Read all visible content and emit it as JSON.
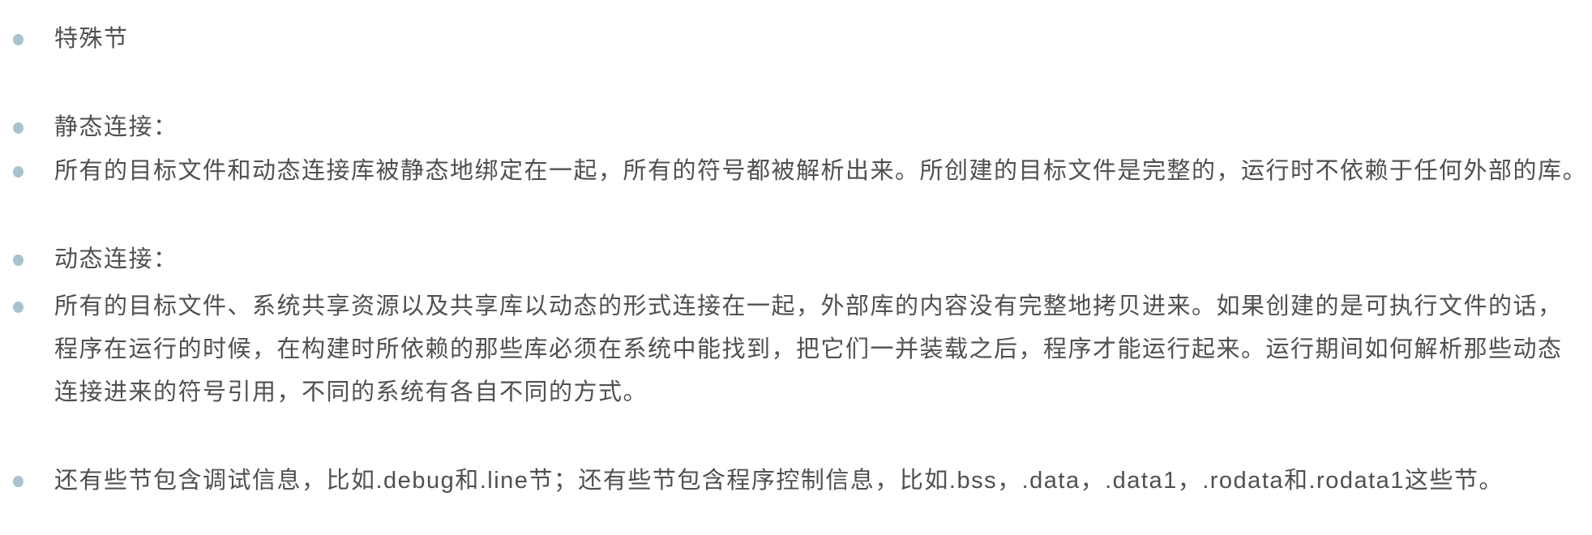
{
  "colors": {
    "bullet": "#a8c3cf",
    "text": "#505050"
  },
  "items": [
    {
      "text": "特殊节"
    },
    {
      "text": "静态连接："
    },
    {
      "text": "所有的目标文件和动态连接库被静态地绑定在一起，所有的符号都被解析出来。所创建的目标文件是完整的，运行时不依赖于任何外部的库。"
    },
    {
      "text": "动态连接："
    },
    {
      "lines": [
        "所有的目标文件、系统共享资源以及共享库以动态的形式连接在一起，外部库的内容没有完整地拷贝进来。如果创建的是可执行文件的话，",
        "程序在运行的时候，在构建时所依赖的那些库必须在系统中能找到，把它们一并装载之后，程序才能运行起来。运行期间如何解析那些动态",
        "连接进来的符号引用，不同的系统有各自不同的方式。"
      ]
    },
    {
      "text": "还有些节包含调试信息，比如.debug和.line节；还有些节包含程序控制信息，比如.bss，.data，.data1，.rodata和.rodata1这些节。"
    }
  ]
}
